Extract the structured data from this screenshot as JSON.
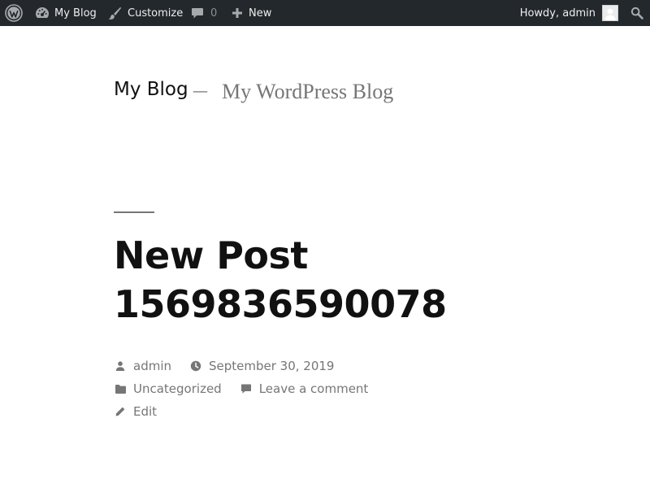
{
  "admin_bar": {
    "site_name": "My Blog",
    "customize": "Customize",
    "comments_count": "0",
    "new": "New",
    "greeting": "Howdy, admin"
  },
  "header": {
    "site_title": "My Blog",
    "separator": "—",
    "description": "My WordPress Blog"
  },
  "post": {
    "title": "New Post 1569836590078",
    "author": "admin",
    "date": "September 30, 2019",
    "category": "Uncategorized",
    "comment_link": "Leave a comment",
    "edit": "Edit"
  },
  "colors": {
    "admin_bar_bg": "#23282d",
    "meta_text": "#767676",
    "title_text": "#111111"
  },
  "icons": {
    "wp_logo": "wordpress-logo-icon",
    "site": "dashboard-icon",
    "customize": "paintbrush-icon",
    "comments": "comment-bubble-icon",
    "new": "plus-icon",
    "search": "search-icon",
    "author": "person-icon",
    "date": "clock-icon",
    "category": "folder-icon",
    "comment": "comment-icon",
    "edit": "pencil-icon"
  }
}
